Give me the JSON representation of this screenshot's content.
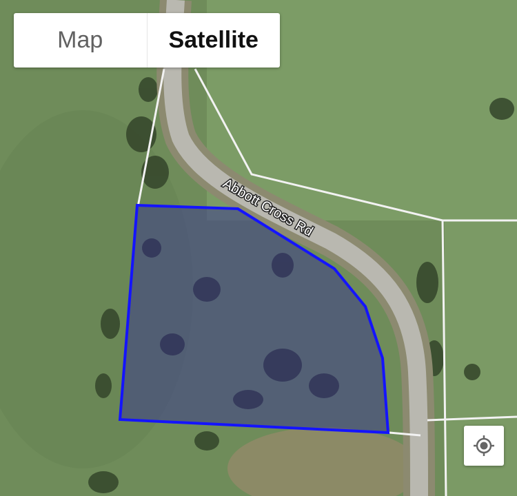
{
  "map_type_toggle": {
    "map_label": "Map",
    "satellite_label": "Satellite",
    "selected": "Satellite"
  },
  "road": {
    "name": "Abbott Cross Rd"
  },
  "locate_button": {
    "icon": "crosshair-location-icon"
  },
  "colors": {
    "parcel_outline": "#1414ff",
    "parcel_fill": "#3c3c8c",
    "property_lines": "#f2f2f2",
    "grass": "#7a9a63"
  }
}
